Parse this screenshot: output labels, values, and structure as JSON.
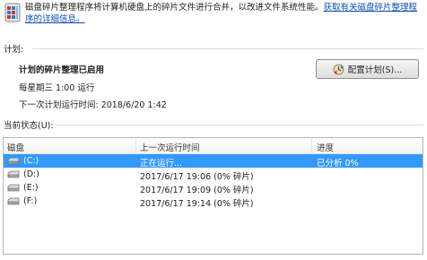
{
  "intro": {
    "text": "磁盘碎片整理程序将计算机硬盘上的碎片文件进行合并，以改进文件系统性能。",
    "link": "获取有关磁盘碎片整理程序的详细信息。"
  },
  "schedule": {
    "section_label": "计划:",
    "status_title": "计划的碎片整理已启用",
    "frequency": "每星期三  1:00 运行",
    "next_run": "下一次计划运行时间: 2018/6/20 1:42",
    "configure_button": "配置计划(S)..."
  },
  "current_status": {
    "section_label": "当前状态(U):",
    "columns": [
      "磁盘",
      "上一次运行时间",
      "进度"
    ],
    "rows": [
      {
        "disk": "(C:)",
        "last_run": "正在运行...",
        "progress": "已分析 0%",
        "selected": true
      },
      {
        "disk": "(D:)",
        "last_run": "2017/6/17 19:06 (0% 碎片)",
        "progress": ""
      },
      {
        "disk": "(E:)",
        "last_run": "2017/6/17 19:09 (0% 碎片)",
        "progress": ""
      },
      {
        "disk": "(F:)",
        "last_run": "2017/6/17 19:14 (0% 碎片)",
        "progress": ""
      }
    ]
  },
  "colors": {
    "selection": "#3399ff",
    "link": "#0a4fb4"
  },
  "icons": {
    "app": "defragmenter-icon",
    "configure": "schedule-shield-icon",
    "disk": "hard-disk-icon"
  }
}
